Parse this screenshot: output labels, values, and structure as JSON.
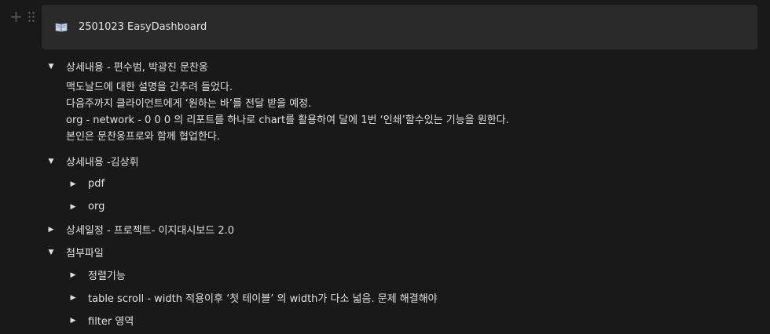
{
  "callout": {
    "icon": "open-book-icon",
    "title": "2501023 EasyDashboard"
  },
  "sections": [
    {
      "title": "상세내용 - 편수범, 박광진 문찬웅",
      "expanded": true,
      "lines": [
        "맥도날드에 대한 설명을 간추려 들었다.",
        "다음주까지 클라이언트에게 ‘원하는 바’를 전달 받을 예정.",
        "org - network - 0 0 0 의 리포트를 하나로 chart를 활용하여 달에 1번 ‘인쇄’할수있는 기능을 원한다.",
        "본인은 문찬웅프로와 함께 협업한다."
      ]
    },
    {
      "title": "상세내용 -김상휘",
      "expanded": true,
      "children": [
        "pdf",
        "org"
      ]
    },
    {
      "title": "상세일정  - 프로젝트- 이지대시보드 2.0",
      "expanded": false
    },
    {
      "title": "첨부파일",
      "expanded": true,
      "children": [
        "정렬기능",
        "table scroll - width 적용이후 ‘첫 테이블’ 의 width가 다소 넓음. 문제 해결해야",
        "filter 영역"
      ]
    }
  ]
}
